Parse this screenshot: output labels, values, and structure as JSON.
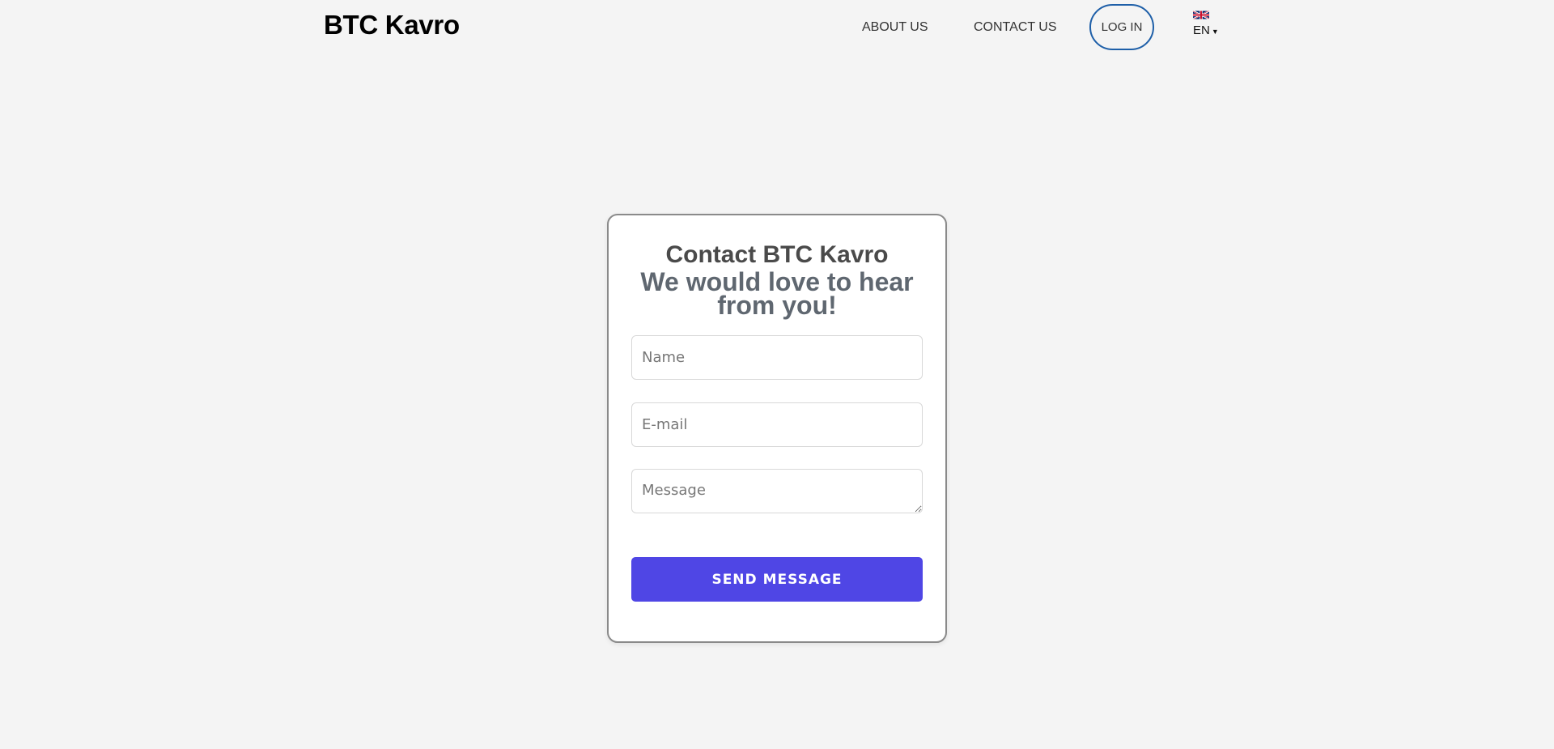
{
  "header": {
    "brand": "BTC Kavro",
    "nav": {
      "about": "ABOUT US",
      "contact": "CONTACT US"
    },
    "login_label": "LOG IN",
    "language": {
      "code": "EN",
      "flag_icon": "uk-flag-icon"
    }
  },
  "contact_form": {
    "title": "Contact BTC Kavro",
    "subtitle": "We would love to hear from you!",
    "name_placeholder": "Name",
    "email_placeholder": "E-mail",
    "message_placeholder": "Message",
    "submit_label": "SEND MESSAGE"
  },
  "colors": {
    "background": "#f4f4f4",
    "accent": "#4f46e5",
    "login_border": "#1e5fa8"
  }
}
